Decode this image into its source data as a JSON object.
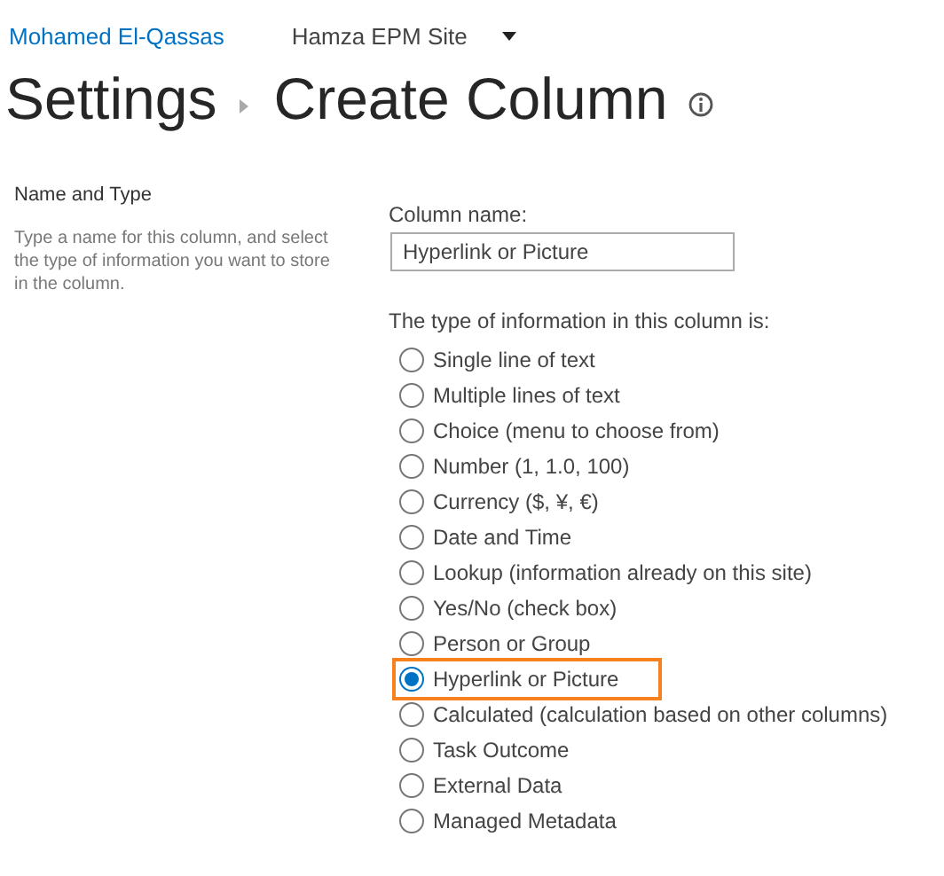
{
  "header": {
    "user": "Mohamed El-Qassas",
    "site": "Hamza EPM Site"
  },
  "breadcrumb": {
    "parent": "Settings",
    "title": "Create Column"
  },
  "section": {
    "title": "Name and Type",
    "description": "Type a name for this column, and select the type of information you want to store in the column."
  },
  "column_name": {
    "label": "Column name:",
    "value": "Hyperlink or Picture"
  },
  "type_prompt": "The type of information in this column is:",
  "types": [
    {
      "label": "Single line of text",
      "selected": false,
      "highlighted": false
    },
    {
      "label": "Multiple lines of text",
      "selected": false,
      "highlighted": false
    },
    {
      "label": "Choice (menu to choose from)",
      "selected": false,
      "highlighted": false
    },
    {
      "label": "Number (1, 1.0, 100)",
      "selected": false,
      "highlighted": false
    },
    {
      "label": "Currency ($, ¥, €)",
      "selected": false,
      "highlighted": false
    },
    {
      "label": "Date and Time",
      "selected": false,
      "highlighted": false
    },
    {
      "label": "Lookup (information already on this site)",
      "selected": false,
      "highlighted": false
    },
    {
      "label": "Yes/No (check box)",
      "selected": false,
      "highlighted": false
    },
    {
      "label": "Person or Group",
      "selected": false,
      "highlighted": false
    },
    {
      "label": "Hyperlink or Picture",
      "selected": true,
      "highlighted": true
    },
    {
      "label": "Calculated (calculation based on other columns)",
      "selected": false,
      "highlighted": false
    },
    {
      "label": "Task Outcome",
      "selected": false,
      "highlighted": false
    },
    {
      "label": "External Data",
      "selected": false,
      "highlighted": false
    },
    {
      "label": "Managed Metadata",
      "selected": false,
      "highlighted": false
    }
  ]
}
